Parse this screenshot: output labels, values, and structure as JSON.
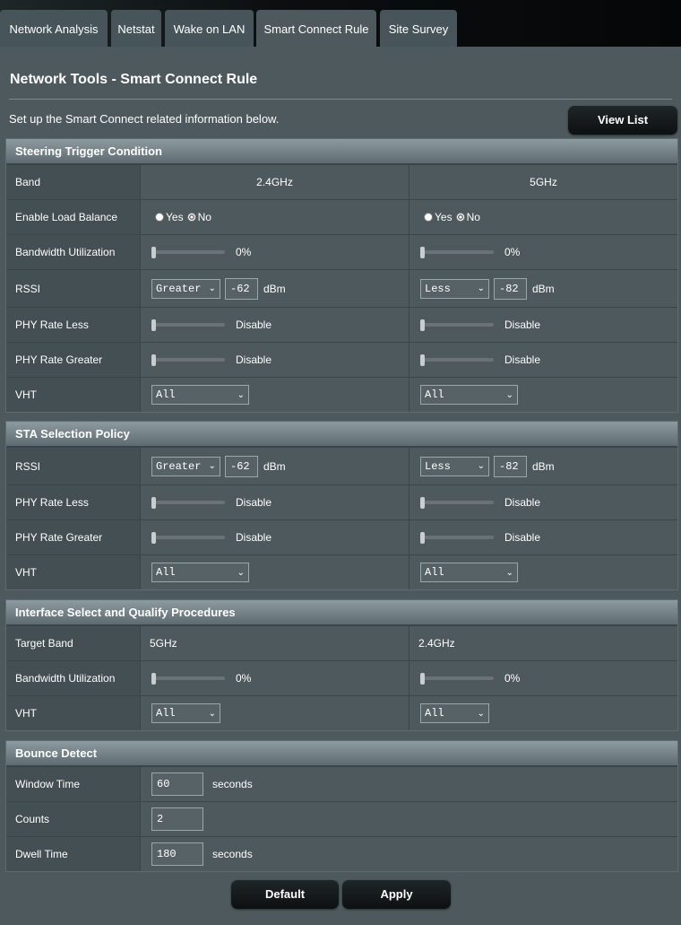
{
  "tabs": [
    "Network Analysis",
    "Netstat",
    "Wake on LAN",
    "Smart Connect Rule",
    "Site Survey"
  ],
  "page_title": "Network Tools - Smart Connect Rule",
  "description": "Set up the Smart Connect related information below.",
  "view_list_label": "View List",
  "steering": {
    "title": "Steering Trigger Condition",
    "band_label": "Band",
    "band1": "2.4GHz",
    "band2": "5GHz",
    "load_balance_label": "Enable Load Balance",
    "yes": "Yes",
    "no": "No",
    "bw_label": "Bandwidth Utilization",
    "bw1": "0%",
    "bw2": "0%",
    "rssi_label": "RSSI",
    "rssi1_op": "Greater",
    "rssi1_val": "-62",
    "rssi2_op": "Less",
    "rssi2_val": "-82",
    "unit": "dBm",
    "phy_less_label": "PHY Rate Less",
    "phy_greater_label": "PHY Rate Greater",
    "disable": "Disable",
    "vht_label": "VHT",
    "vht1": "All",
    "vht2": "All"
  },
  "sta": {
    "title": "STA Selection Policy",
    "rssi_label": "RSSI",
    "rssi1_op": "Greater",
    "rssi1_val": "-62",
    "rssi2_op": "Less",
    "rssi2_val": "-82",
    "unit": "dBm",
    "phy_less_label": "PHY Rate Less",
    "phy_greater_label": "PHY Rate Greater",
    "disable": "Disable",
    "vht_label": "VHT",
    "vht1": "All",
    "vht2": "All"
  },
  "iface": {
    "title": "Interface Select and Qualify Procedures",
    "target_label": "Target Band",
    "target1": "5GHz",
    "target2": "2.4GHz",
    "bw_label": "Bandwidth Utilization",
    "bw1": "0%",
    "bw2": "0%",
    "vht_label": "VHT",
    "vht1": "All",
    "vht2": "All"
  },
  "bounce": {
    "title": "Bounce Detect",
    "window_label": "Window Time",
    "window_val": "60",
    "counts_label": "Counts",
    "counts_val": "2",
    "dwell_label": "Dwell Time",
    "dwell_val": "180",
    "seconds": "seconds"
  },
  "default_label": "Default",
  "apply_label": "Apply"
}
